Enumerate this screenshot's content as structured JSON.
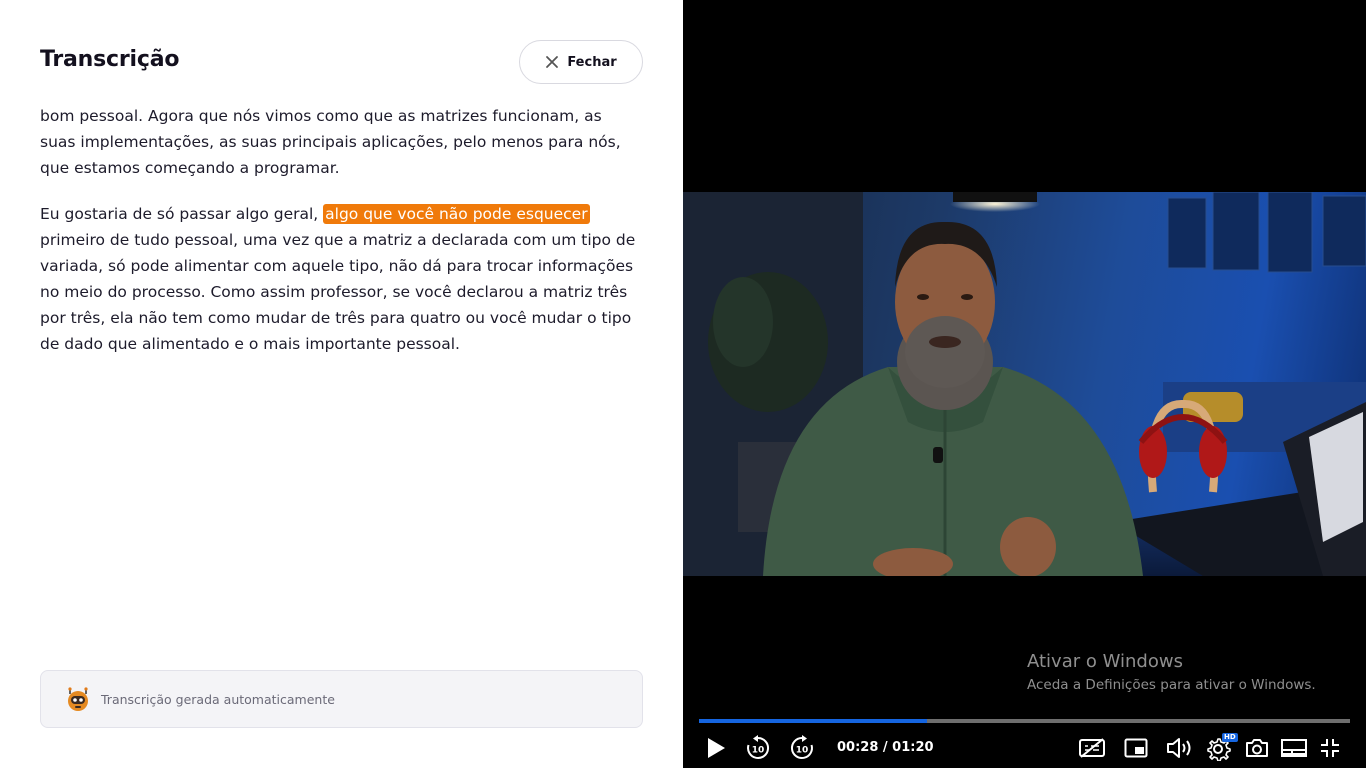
{
  "panel": {
    "title": "Transcrição",
    "close_label": "Fechar",
    "paragraph1": "bom pessoal. Agora que nós vimos como que as matrizes funcionam, as suas implementações, as suas principais aplicações, pelo menos para nós, que estamos começando a programar.",
    "paragraph2_before": "Eu gostaria de só passar algo geral, ",
    "paragraph2_highlight": "algo que você não pode esquecer",
    "paragraph2_after": " primeiro de tudo pessoal, uma vez que a matriz a declarada com um tipo de variada, só pode alimentar com aquele tipo, não dá para trocar informações no meio do processo. Como assim professor, se você declarou a matriz três por três, ela não tem como mudar de três para quatro ou você mudar o tipo de dado que alimentado e o mais importante pessoal.",
    "auto_note": "Transcrição gerada automaticamente"
  },
  "video": {
    "watermark_title": "Ativar o Windows",
    "watermark_subtitle": "Aceda a Definições para ativar o Windows.",
    "time": "00:28 / 01:20",
    "progress_fraction": 0.35,
    "skip_back_seconds": "10",
    "skip_forward_seconds": "10",
    "quality_badge": "HD"
  },
  "colors": {
    "highlight": "#f07a0a",
    "progress": "#1565e0",
    "title": "#13101e"
  },
  "icons": [
    "close-icon",
    "robot-icon",
    "play-icon",
    "rewind-10-icon",
    "forward-10-icon",
    "captions-off-icon",
    "pip-icon",
    "volume-icon",
    "settings-icon",
    "camera-icon",
    "theater-icon",
    "exit-fullscreen-icon"
  ]
}
